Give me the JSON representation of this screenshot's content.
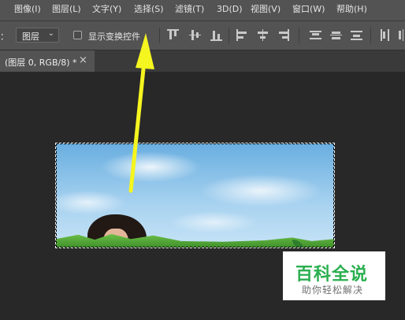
{
  "menubar": {
    "items": [
      {
        "label": "图像(I)"
      },
      {
        "label": "图层(L)"
      },
      {
        "label": "文字(Y)"
      },
      {
        "label": "选择(S)"
      },
      {
        "label": "滤镜(T)"
      },
      {
        "label": "3D(D)"
      },
      {
        "label": "视图(V)"
      },
      {
        "label": "窗口(W)"
      },
      {
        "label": "帮助(H)"
      }
    ]
  },
  "options": {
    "prefix_label": "：",
    "layer_select_value": "图层",
    "show_transform_label": "显示变换控件",
    "show_transform_checked": false
  },
  "document": {
    "tab_title": "(图层 0, RGB/8) *",
    "close_glyph": "×"
  },
  "watermark": {
    "title": "百科全说",
    "subtitle": "助你轻松解决",
    "color": "#2aaf4f"
  },
  "annotation": {
    "arrow_color": "#f5f51f",
    "points_to": "选择(S)"
  },
  "colors": {
    "menubar_bg": "#535353",
    "workspace_bg": "#282828"
  }
}
